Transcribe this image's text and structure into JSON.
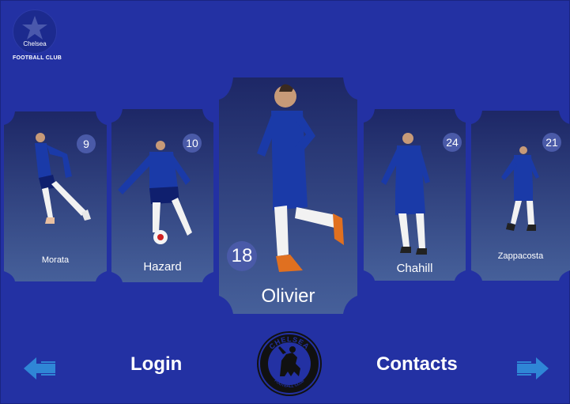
{
  "brand": {
    "logo_text": "Chelsea",
    "club_label": "FOOTBALL CLUB"
  },
  "players": [
    {
      "name": "Morata",
      "number": "9"
    },
    {
      "name": "Hazard",
      "number": "10"
    },
    {
      "name": "Olivier",
      "number": "18"
    },
    {
      "name": "Chahill",
      "number": "24"
    },
    {
      "name": "Zappacosta",
      "number": "21"
    }
  ],
  "nav": {
    "login": "Login",
    "contacts": "Contacts"
  },
  "crest": {
    "top_text": "CHELSEA",
    "bottom_text": "FOOTBALL CLUB"
  },
  "colors": {
    "background": "#2331a3",
    "card_top": "#1d2766",
    "card_bottom": "#46609a",
    "badge": "#4a5aa8",
    "arrow": "#2f86d6"
  },
  "icons": {
    "logo": "star-icon",
    "prev": "arrow-left-icon",
    "next": "arrow-right-icon"
  }
}
